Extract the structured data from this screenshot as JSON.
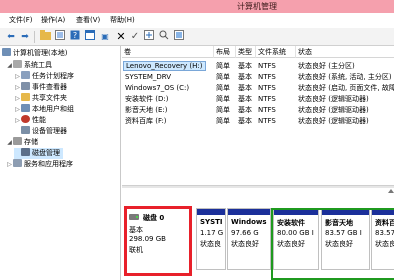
{
  "window": {
    "title": "计算机管理"
  },
  "menu": [
    "文件(F)",
    "操作(A)",
    "查看(V)",
    "帮助(H)"
  ],
  "toolbar": {
    "icons": [
      "back-arrow-icon",
      "forward-arrow-icon",
      "folder-up-icon",
      "properties-icon",
      "help-icon",
      "panel-icon",
      "delete-icon",
      "checkmark-icon",
      "new-icon",
      "search-icon",
      "view-icon"
    ]
  },
  "tree": {
    "root": "计算机管理(本地)",
    "items": [
      {
        "label": "系统工具",
        "level": 1,
        "expander": "◢"
      },
      {
        "label": "任务计划程序",
        "level": 2,
        "expander": "▷"
      },
      {
        "label": "事件查看器",
        "level": 2,
        "expander": "▷"
      },
      {
        "label": "共享文件夹",
        "level": 2,
        "expander": "▷"
      },
      {
        "label": "本地用户和组",
        "level": 2,
        "expander": "▷"
      },
      {
        "label": "性能",
        "level": 2,
        "expander": "▷"
      },
      {
        "label": "设备管理器",
        "level": 2,
        "expander": ""
      },
      {
        "label": "存储",
        "level": 1,
        "expander": "◢"
      },
      {
        "label": "磁盘管理",
        "level": 2,
        "expander": "",
        "selected": true
      },
      {
        "label": "服务和应用程序",
        "level": 1,
        "expander": "▷"
      }
    ]
  },
  "volumes": {
    "columns": [
      "卷",
      "布局",
      "类型",
      "文件系统",
      "状态"
    ],
    "rows": [
      {
        "name": "Lenovo_Recovery (H:)",
        "layout": "简单",
        "type": "基本",
        "fs": "NTFS",
        "status": "状态良好 (主分区)",
        "selected": true
      },
      {
        "name": "SYSTEM_DRV",
        "layout": "简单",
        "type": "基本",
        "fs": "NTFS",
        "status": "状态良好 (系统, 活动, 主分区)"
      },
      {
        "name": "Windows7_OS (C:)",
        "layout": "简单",
        "type": "基本",
        "fs": "NTFS",
        "status": "状态良好 (启动, 页面文件, 故障转储)"
      },
      {
        "name": "安装软件 (D:)",
        "layout": "简单",
        "type": "基本",
        "fs": "NTFS",
        "status": "状态良好 (逻辑驱动器)"
      },
      {
        "name": "影音天地 (E:)",
        "layout": "简单",
        "type": "基本",
        "fs": "NTFS",
        "status": "状态良好 (逻辑驱动器)"
      },
      {
        "name": "资料百库 (F:)",
        "layout": "简单",
        "type": "基本",
        "fs": "NTFS",
        "status": "状态良好 (逻辑驱动器)"
      }
    ]
  },
  "disk": {
    "name": "磁盘 0",
    "type": "基本",
    "size": "298.09 GB",
    "status": "联机",
    "partitions": [
      {
        "name": "SYSTI",
        "size": "1.17 G",
        "status": "状态良"
      },
      {
        "name": "Windows",
        "size": "97.66 G",
        "status": "状态良好"
      },
      {
        "name": "安装软件",
        "size": "80.00 GB I",
        "status": "状态良好"
      },
      {
        "name": "影音天地",
        "size": "83.57 GB I",
        "status": "状态良好"
      },
      {
        "name": "资料百",
        "size": "83.57 G",
        "status": "状态良"
      }
    ]
  },
  "colors": {
    "titlebar": "#f5a0ad",
    "partition_bar": "#1b2f9a",
    "highlight_red": "#e8202a",
    "highlight_green": "#1f9a1f"
  }
}
